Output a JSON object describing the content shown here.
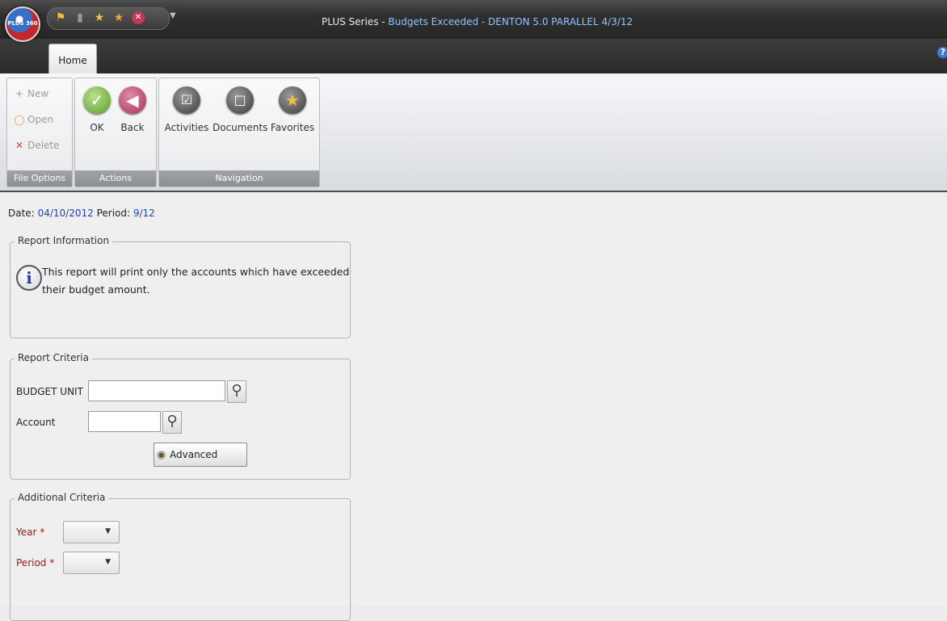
{
  "window": {
    "title_prefix": "PLUS Series - ",
    "title_highlight": "Budgets Exceeded - DENTON 5.0 PARALLEL 4/3/12",
    "app_orb_label": "PLUS 360",
    "help_glyph": "?"
  },
  "tabs": [
    {
      "label": "Home"
    }
  ],
  "ribbon": {
    "file_options": {
      "label": "File Options",
      "items": [
        {
          "label": "New",
          "icon": "plus-icon"
        },
        {
          "label": "Open",
          "icon": "open-icon"
        },
        {
          "label": "Delete",
          "icon": "delete-icon"
        }
      ]
    },
    "actions": {
      "label": "Actions",
      "items": [
        {
          "label": "OK",
          "icon": "checkmark-icon",
          "color": "#5a9e2a"
        },
        {
          "label": "Back",
          "icon": "back-arrow-icon",
          "color": "#a8325a"
        }
      ]
    },
    "navigation": {
      "label": "Navigation",
      "items": [
        {
          "label": "Activities",
          "icon": "activities-icon"
        },
        {
          "label": "Documents",
          "icon": "documents-icon"
        },
        {
          "label": "Favorites",
          "icon": "star-icon"
        }
      ]
    }
  },
  "header_info": {
    "date_label": "Date:",
    "date_value": "04/10/2012",
    "period_label": "Period:",
    "period_value": "9/12"
  },
  "report_information": {
    "legend": "Report Information",
    "text_line1": "This report will print only the accounts which have exceeded",
    "text_line2": "their budget amount."
  },
  "report_criteria": {
    "legend": "Report Criteria",
    "budget_unit_label": "BUDGET UNIT",
    "budget_unit_value": "",
    "account_label": "Account",
    "account_value": "",
    "advanced_label": "Advanced"
  },
  "additional_criteria": {
    "legend": "Additional Criteria",
    "year_label": "Year *",
    "year_value": "",
    "period_label": "Period *",
    "period_value": ""
  },
  "colors": {
    "link_blue": "#2142b5",
    "required_red": "#8b1c1c",
    "group_label_gray": "#8c8f94"
  }
}
